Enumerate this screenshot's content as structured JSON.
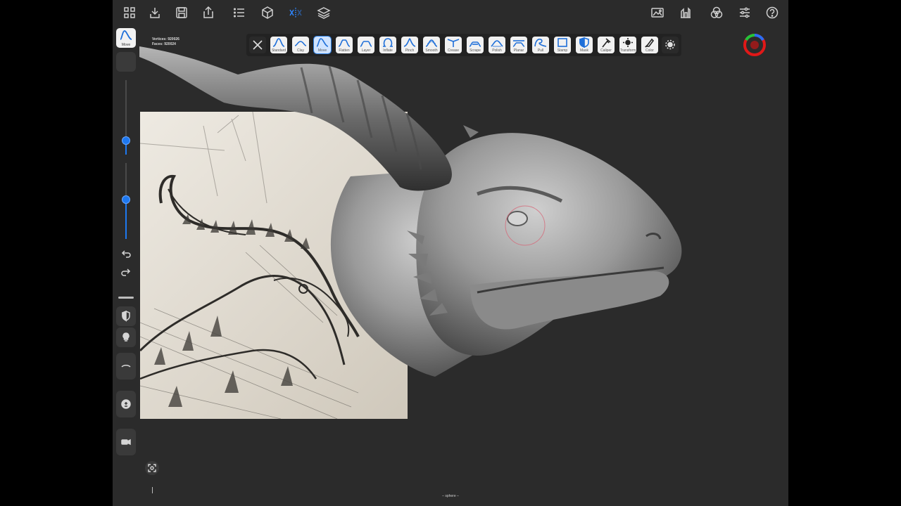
{
  "stats": {
    "vertices": "Vertices: 920026",
    "faces": "Faces: 920024"
  },
  "sidebar": {
    "active_tool_label": "Move"
  },
  "toolbar": {
    "tools": [
      {
        "label": "Standard"
      },
      {
        "label": "Clay"
      },
      {
        "label": "Move"
      },
      {
        "label": "Flatten"
      },
      {
        "label": "Layer"
      },
      {
        "label": "Inflate"
      },
      {
        "label": "Pinch"
      },
      {
        "label": "Smooth"
      },
      {
        "label": "Crease"
      },
      {
        "label": "Scrape"
      },
      {
        "label": "Polish"
      },
      {
        "label": "Planar"
      },
      {
        "label": "Pull"
      },
      {
        "label": "Stamp"
      },
      {
        "label": "Mask"
      },
      {
        "label": "Caliper"
      },
      {
        "label": "Transform"
      },
      {
        "label": "Color"
      }
    ]
  },
  "bottom": {
    "object_name": "– sphere –"
  },
  "colors": {
    "accent": "#1e78f0",
    "background": "#2b2b2b",
    "toolbar": "#222222"
  }
}
